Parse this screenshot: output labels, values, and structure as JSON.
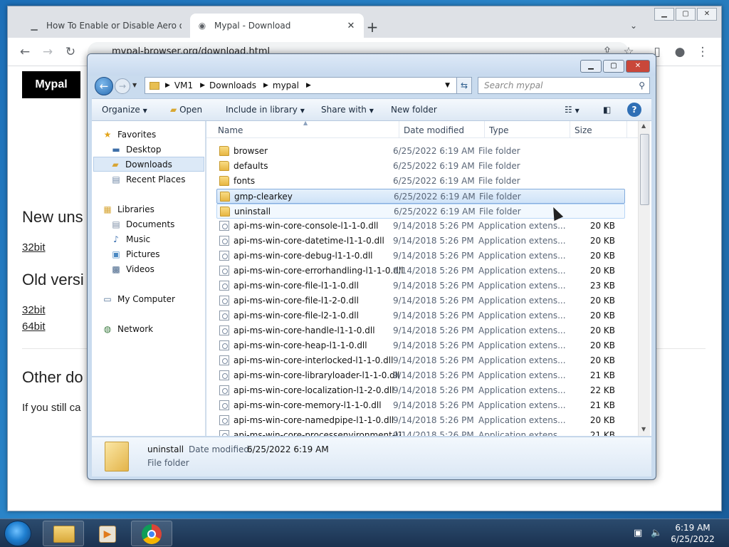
{
  "browser": {
    "tabs": [
      {
        "label": "How To Enable or Disable Aero o",
        "active": false
      },
      {
        "label": "Mypal - Download",
        "active": true
      }
    ],
    "url": "mypal-browser.org/download.html"
  },
  "page": {
    "logo": "Mypal",
    "new_unstable_heading": "New uns",
    "link_32bit_new": "32bit",
    "old_versions_heading": "Old versi",
    "link_32bit_old": "32bit",
    "link_64bit_old": "64bit",
    "other_heading": "Other do",
    "still_text": "If you still ca"
  },
  "explorer": {
    "breadcrumb": [
      "VM1",
      "Downloads",
      "mypal"
    ],
    "search_placeholder": "Search mypal",
    "commands": [
      "Organize",
      "Open",
      "Include in library",
      "Share with",
      "New folder"
    ],
    "nav": {
      "favorites": "Favorites",
      "favorites_items": [
        "Desktop",
        "Downloads",
        "Recent Places"
      ],
      "libraries": "Libraries",
      "libraries_items": [
        "Documents",
        "Music",
        "Pictures",
        "Videos"
      ],
      "computer": "My Computer",
      "network": "Network"
    },
    "columns": {
      "name": "Name",
      "date": "Date modified",
      "type": "Type",
      "size": "Size"
    },
    "files": [
      {
        "name": "browser",
        "date": "6/25/2022 6:19 AM",
        "type": "File folder",
        "size": "",
        "kind": "folder"
      },
      {
        "name": "defaults",
        "date": "6/25/2022 6:19 AM",
        "type": "File folder",
        "size": "",
        "kind": "folder"
      },
      {
        "name": "fonts",
        "date": "6/25/2022 6:19 AM",
        "type": "File folder",
        "size": "",
        "kind": "folder"
      },
      {
        "name": "gmp-clearkey",
        "date": "6/25/2022 6:19 AM",
        "type": "File folder",
        "size": "",
        "kind": "folder"
      },
      {
        "name": "uninstall",
        "date": "6/25/2022 6:19 AM",
        "type": "File folder",
        "size": "",
        "kind": "folder"
      },
      {
        "name": "api-ms-win-core-console-l1-1-0.dll",
        "date": "9/14/2018 5:26 PM",
        "type": "Application extens...",
        "size": "20 KB",
        "kind": "dll"
      },
      {
        "name": "api-ms-win-core-datetime-l1-1-0.dll",
        "date": "9/14/2018 5:26 PM",
        "type": "Application extens...",
        "size": "20 KB",
        "kind": "dll"
      },
      {
        "name": "api-ms-win-core-debug-l1-1-0.dll",
        "date": "9/14/2018 5:26 PM",
        "type": "Application extens...",
        "size": "20 KB",
        "kind": "dll"
      },
      {
        "name": "api-ms-win-core-errorhandling-l1-1-0.dll",
        "date": "9/14/2018 5:26 PM",
        "type": "Application extens...",
        "size": "20 KB",
        "kind": "dll"
      },
      {
        "name": "api-ms-win-core-file-l1-1-0.dll",
        "date": "9/14/2018 5:26 PM",
        "type": "Application extens...",
        "size": "23 KB",
        "kind": "dll"
      },
      {
        "name": "api-ms-win-core-file-l1-2-0.dll",
        "date": "9/14/2018 5:26 PM",
        "type": "Application extens...",
        "size": "20 KB",
        "kind": "dll"
      },
      {
        "name": "api-ms-win-core-file-l2-1-0.dll",
        "date": "9/14/2018 5:26 PM",
        "type": "Application extens...",
        "size": "20 KB",
        "kind": "dll"
      },
      {
        "name": "api-ms-win-core-handle-l1-1-0.dll",
        "date": "9/14/2018 5:26 PM",
        "type": "Application extens...",
        "size": "20 KB",
        "kind": "dll"
      },
      {
        "name": "api-ms-win-core-heap-l1-1-0.dll",
        "date": "9/14/2018 5:26 PM",
        "type": "Application extens...",
        "size": "20 KB",
        "kind": "dll"
      },
      {
        "name": "api-ms-win-core-interlocked-l1-1-0.dll",
        "date": "9/14/2018 5:26 PM",
        "type": "Application extens...",
        "size": "20 KB",
        "kind": "dll"
      },
      {
        "name": "api-ms-win-core-libraryloader-l1-1-0.dll",
        "date": "9/14/2018 5:26 PM",
        "type": "Application extens...",
        "size": "21 KB",
        "kind": "dll"
      },
      {
        "name": "api-ms-win-core-localization-l1-2-0.dll",
        "date": "9/14/2018 5:26 PM",
        "type": "Application extens...",
        "size": "22 KB",
        "kind": "dll"
      },
      {
        "name": "api-ms-win-core-memory-l1-1-0.dll",
        "date": "9/14/2018 5:26 PM",
        "type": "Application extens...",
        "size": "21 KB",
        "kind": "dll"
      },
      {
        "name": "api-ms-win-core-namedpipe-l1-1-0.dll",
        "date": "9/14/2018 5:26 PM",
        "type": "Application extens...",
        "size": "20 KB",
        "kind": "dll"
      },
      {
        "name": "api-ms-win-core-processenvironment-l1",
        "date": "9/14/2018 5:26 PM",
        "type": "Application extens...",
        "size": "21 KB",
        "kind": "dll"
      }
    ],
    "selected_index": 3,
    "hover_index": 4,
    "details": {
      "name": "uninstall",
      "date_label": "Date modified:",
      "date_value": "6/25/2022 6:19 AM",
      "type": "File folder"
    }
  },
  "taskbar": {
    "time": "6:19 AM",
    "date": "6/25/2022"
  },
  "colors": {
    "selection_border": "#84acdd",
    "selection_fill": "#cfe3f8",
    "taskbar": "#1b3250"
  }
}
